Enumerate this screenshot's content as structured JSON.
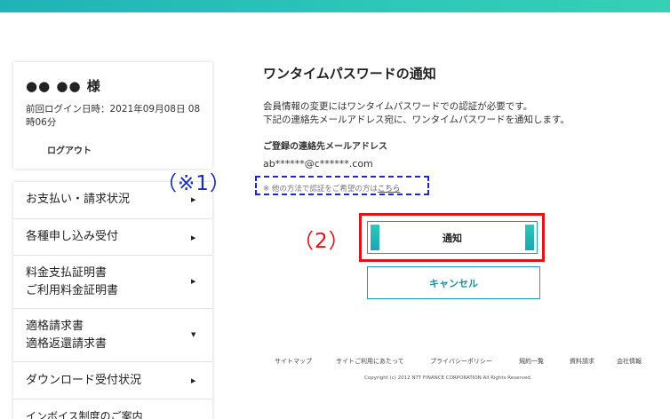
{
  "header": {
    "accent_color": "#2ec8b8"
  },
  "user": {
    "name": "●● ●● 様",
    "last_login": "前回ログイン日時：2021年09月08日 08時06分",
    "logout_label": "ログアウト"
  },
  "sidebar": {
    "items": [
      {
        "label": "お支払い・請求状況",
        "icon": "chevron-right-icon"
      },
      {
        "label": "各種申し込み受付",
        "icon": "chevron-right-icon"
      },
      {
        "label": "料金支払証明書\nご利用料金証明書",
        "icon": "chevron-right-icon"
      },
      {
        "label": "適格請求書\n適格返還請求書",
        "icon": "chevron-down-icon"
      },
      {
        "label": "ダウンロード受付状況",
        "icon": "chevron-right-icon"
      },
      {
        "label": "インボイス制度のご案内",
        "icon": ""
      }
    ]
  },
  "main": {
    "title": "ワンタイムパスワードの通知",
    "description": "会員情報の変更にはワンタイムパスワードでの認証が必要です。\n下記の連絡先メールアドレス宛に、ワンタイムパスワードを通知します。",
    "email_label": "ご登録の連絡先メールアドレス",
    "email_value": "ab******@c******.com",
    "note_prefix": "※ 他の方法で認証をご希望の方は",
    "note_link": "こちら",
    "notify_button": "通知",
    "cancel_button": "キャンセル"
  },
  "annotations": {
    "mark1": "（※1）",
    "mark2": "（2）",
    "mark1_color": "#1a2fb5",
    "mark2_color": "#e0141a"
  },
  "footer": {
    "links": [
      "サイトマップ",
      "サイトご利用にあたって",
      "プライバシーポリシー",
      "規約一覧",
      "資料請求",
      "会社情報"
    ],
    "copyright": "Copyright (c) 2012 NTT FINANCE CORPORATION All Rights Reserved."
  }
}
